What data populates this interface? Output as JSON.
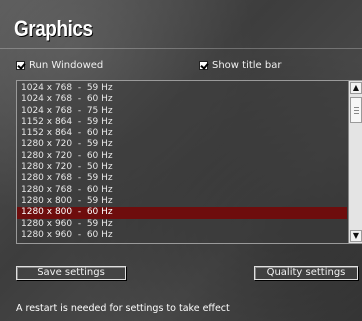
{
  "header": {
    "title": "Graphics"
  },
  "options": {
    "run_windowed": {
      "label": "Run Windowed",
      "checked": true
    },
    "show_title_bar": {
      "label": "Show title bar",
      "checked": true
    }
  },
  "resolutions": {
    "items": [
      "1024 x 768  -  59 Hz",
      "1024 x 768  -  60 Hz",
      "1024 x 768  -  75 Hz",
      "1152 x 864  -  59 Hz",
      "1152 x 864  -  60 Hz",
      "1280 x 720  -  59 Hz",
      "1280 x 720  -  60 Hz",
      "1280 x 720  -  50 Hz",
      "1280 x 768  -  59 Hz",
      "1280 x 768  -  60 Hz",
      "1280 x 800  -  59 Hz",
      "1280 x 800  -  60 Hz",
      "1280 x 960  -  59 Hz",
      "1280 x 960  -  60 Hz"
    ],
    "selected_index": 11
  },
  "buttons": {
    "save_label": "Save settings",
    "quality_label": "Quality settings"
  },
  "status": {
    "message": "A restart is needed for settings to take effect"
  },
  "colors": {
    "selection": "#6e0d0d"
  }
}
